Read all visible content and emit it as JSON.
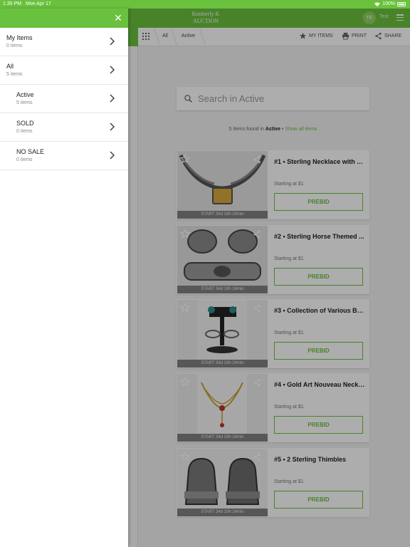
{
  "status_bar": {
    "time": "1:35 PM",
    "date": "Mon Apr 17",
    "battery": "100%"
  },
  "header": {
    "logo_line1": "Kimberly K",
    "logo_line2": "AUCTION",
    "avatar_initials": "TE",
    "user_name": "Test"
  },
  "toolbar": {
    "breadcrumb_all": "All",
    "breadcrumb_active": "Active",
    "my_items_label": "MY ITEMS",
    "print_label": "PRINT",
    "share_label": "SHARE"
  },
  "search": {
    "placeholder": "Search in Active"
  },
  "results": {
    "count_text": "5 items found in",
    "category": "Active",
    "separator": "•",
    "show_all": "Show all items"
  },
  "items": [
    {
      "title": "#1 • Sterling Necklace with Y...",
      "starting": "Starting at $1",
      "prebid_label": "PREBID",
      "timer": "START 34d 19h 24min",
      "image_icon": "necklace-image"
    },
    {
      "title": "#2 • Sterling Horse Themed ...",
      "starting": "Starting at $1",
      "prebid_label": "PREBID",
      "timer": "START 34d 19h 24min",
      "image_icon": "horse-pins-image"
    },
    {
      "title": "#3 • Collection of Various Be...",
      "starting": "Starting at $1",
      "prebid_label": "PREBID",
      "timer": "START 34d 19h 24min",
      "image_icon": "bracelets-image"
    },
    {
      "title": "#4 • Gold Art Nouveau Neckl...",
      "starting": "Starting at $1",
      "prebid_label": "PREBID",
      "timer": "START 34d 19h 24min",
      "image_icon": "gold-necklace-image"
    },
    {
      "title": "#5 • 2 Sterling Thimbles",
      "starting": "Starting at $1",
      "prebid_label": "PREBID",
      "timer": "START 34d 19h 24min",
      "image_icon": "thimbles-image"
    }
  ],
  "drawer": {
    "items": [
      {
        "label": "My Items",
        "count": "0 items"
      },
      {
        "label": "All",
        "count": "5 items"
      },
      {
        "label": "Active",
        "count": "5 items"
      },
      {
        "label": "SOLD",
        "count": "0 items"
      },
      {
        "label": "NO SALE",
        "count": "0 items"
      }
    ]
  },
  "colors": {
    "brand_green": "#6ac13e",
    "overlay": "rgba(0,0,0,0.32)"
  }
}
